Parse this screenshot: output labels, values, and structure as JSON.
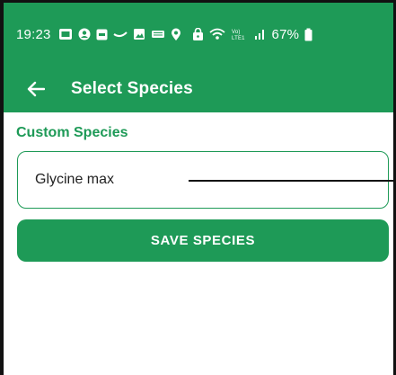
{
  "status_bar": {
    "time": "19:23",
    "battery_percent": "67%",
    "icons": [
      "gallery-icon",
      "user-icon",
      "app-icon",
      "minus-icon",
      "image-icon",
      "keyboard-icon",
      "location-icon",
      "lock-icon",
      "wifi-icon",
      "volte-icon",
      "signal-icon",
      "battery-icon"
    ]
  },
  "app_bar": {
    "title": "Select Species",
    "back_icon": "arrow-left-icon"
  },
  "form": {
    "section_label": "Custom Species",
    "species_value": "Glycine max",
    "save_label": "SAVE SPECIES"
  },
  "colors": {
    "primary": "#1e9a57",
    "background": "#ffffff",
    "text": "#222222"
  }
}
